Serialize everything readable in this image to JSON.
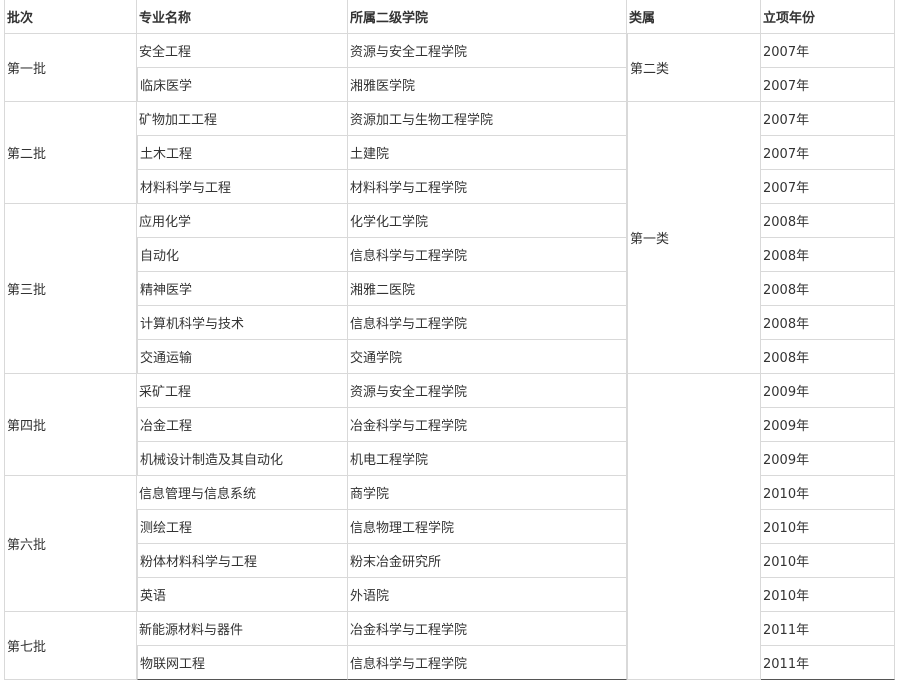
{
  "table": {
    "headers": [
      "批次",
      "专业名称",
      "所属二级学院",
      "类属",
      "立项年份"
    ],
    "batches": [
      "第一批",
      "第二批",
      "第三批",
      "第四批",
      "第六批",
      "第七批"
    ],
    "categories": [
      "第二类",
      "第一类"
    ],
    "rows": [
      {
        "major": "安全工程",
        "college": "资源与安全工程学院",
        "year": "2007年"
      },
      {
        "major": "临床医学",
        "college": "湘雅医学院",
        "year": "2007年"
      },
      {
        "major": "矿物加工工程",
        "college": "资源加工与生物工程学院",
        "year": "2007年"
      },
      {
        "major": "土木工程",
        "college": "土建院",
        "year": "2007年"
      },
      {
        "major": "材料科学与工程",
        "college": "材料科学与工程学院",
        "year": "2007年"
      },
      {
        "major": "应用化学",
        "college": "化学化工学院",
        "year": "2008年"
      },
      {
        "major": "自动化",
        "college": "信息科学与工程学院",
        "year": "2008年"
      },
      {
        "major": "精神医学",
        "college": "湘雅二医院",
        "year": "2008年"
      },
      {
        "major": "计算机科学与技术",
        "college": "信息科学与工程学院",
        "year": "2008年"
      },
      {
        "major": "交通运输",
        "college": "交通学院",
        "year": "2008年"
      },
      {
        "major": "采矿工程",
        "college": "资源与安全工程学院",
        "year": "2009年"
      },
      {
        "major": "冶金工程",
        "college": "冶金科学与工程学院",
        "year": "2009年"
      },
      {
        "major": "机械设计制造及其自动化",
        "college": "机电工程学院",
        "year": "2009年"
      },
      {
        "major": "信息管理与信息系统",
        "college": "商学院",
        "year": "2010年"
      },
      {
        "major": "测绘工程",
        "college": "信息物理工程学院",
        "year": "2010年"
      },
      {
        "major": "粉体材料科学与工程",
        "college": "粉末冶金研究所",
        "year": "2010年"
      },
      {
        "major": "英语",
        "college": "外语院",
        "year": "2010年"
      },
      {
        "major": "新能源材料与器件",
        "college": "冶金科学与工程学院",
        "year": "2011年"
      },
      {
        "major": "物联网工程",
        "college": "信息科学与工程学院",
        "year": "2011年"
      }
    ]
  }
}
